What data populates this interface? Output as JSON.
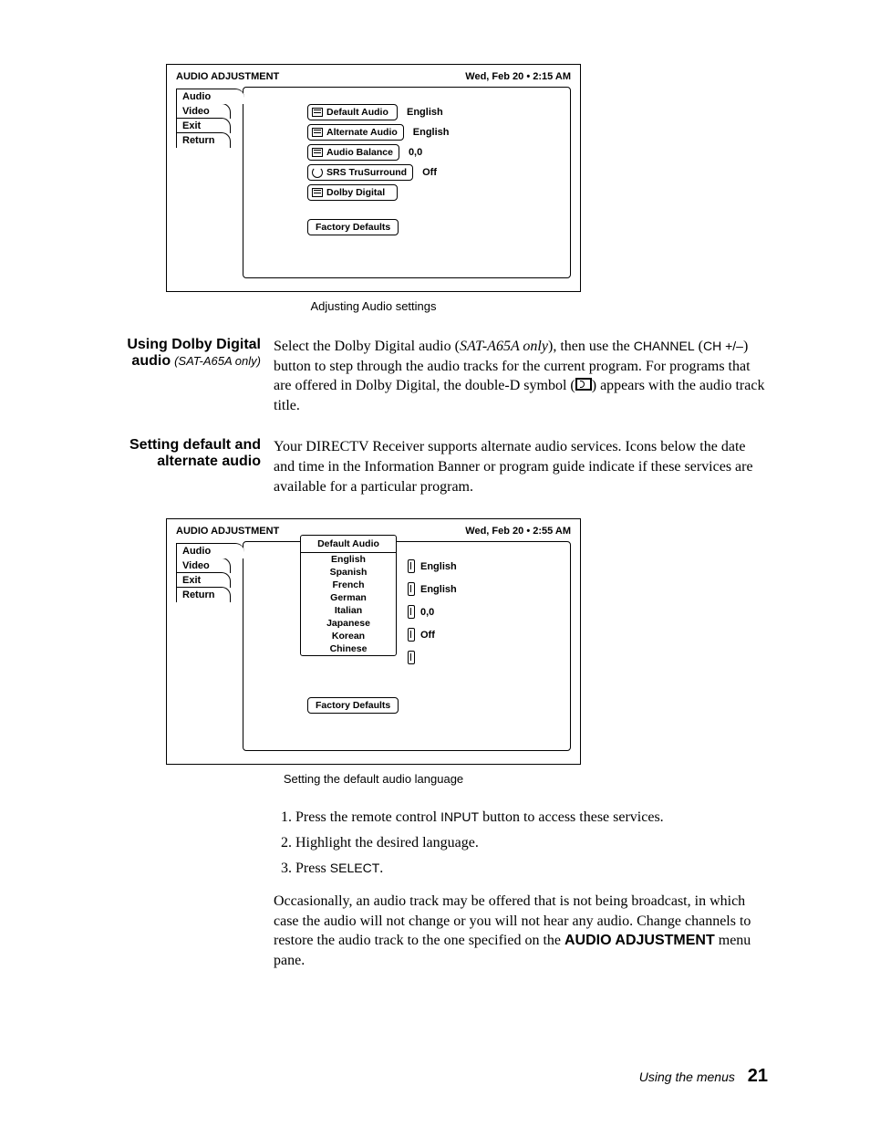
{
  "fig1": {
    "title": "AUDIO ADJUSTMENT",
    "timestamp": "Wed, Feb 20  •  2:15 AM",
    "tabs": [
      "Audio",
      "Video",
      "Exit",
      "Return"
    ],
    "options": [
      {
        "label": "Default Audio",
        "value": "English",
        "icon": "list"
      },
      {
        "label": "Alternate Audio",
        "value": "English",
        "icon": "list"
      },
      {
        "label": "Audio Balance",
        "value": "0,0",
        "icon": "list"
      },
      {
        "label": "SRS TruSurround",
        "value": "Off",
        "icon": "cycle"
      },
      {
        "label": "Dolby Digital",
        "value": "",
        "icon": "list"
      }
    ],
    "factory": "Factory Defaults",
    "caption": "Adjusting Audio settings"
  },
  "sec1": {
    "heading": "Using Dolby Digital audio",
    "note": "(SAT-A65A only)",
    "body_a": "Select the Dolby Digital audio (",
    "body_a_ital": "SAT-A65A only",
    "body_b": "), then use the ",
    "body_c": "CHANNEL",
    "body_d": " (",
    "body_e": "CH +/–",
    "body_f": ") button to step through the audio tracks for the current program. For programs that are offered in Dolby Digital, the double-D symbol (",
    "body_g": ") appears with the audio track title."
  },
  "sec2": {
    "heading": "Setting default and alternate audio",
    "body": "Your DIRECTV Receiver supports alternate audio services. Icons below the date and time in the Information Banner or program guide indicate if these services are available for a particular program."
  },
  "fig2": {
    "title": "AUDIO ADJUSTMENT",
    "timestamp": "Wed, Feb 20  •  2:55 AM",
    "tabs": [
      "Audio",
      "Video",
      "Exit",
      "Return"
    ],
    "popup_title": "Default Audio",
    "languages": [
      "English",
      "Spanish",
      "French",
      "German",
      "Italian",
      "Japanese",
      "Korean",
      "Chinese"
    ],
    "values": [
      "English",
      "English",
      "0,0",
      "Off"
    ],
    "factory": "Factory Defaults",
    "caption": "Setting the default audio language"
  },
  "steps": {
    "s1a": "Press the remote control ",
    "s1b": "INPUT",
    "s1c": " button to access these services.",
    "s2": "Highlight the desired language.",
    "s3a": "Press ",
    "s3b": "SELECT",
    "s3c": "."
  },
  "closing": {
    "a": "Occasionally, an audio track may be offered that is not being broadcast, in which case the audio will not change or you will not hear any audio. Change channels to restore the audio track to the one specified on the ",
    "b": "AUDIO ADJUSTMENT",
    "c": " menu pane."
  },
  "footer": {
    "text": "Using the menus",
    "page": "21"
  }
}
